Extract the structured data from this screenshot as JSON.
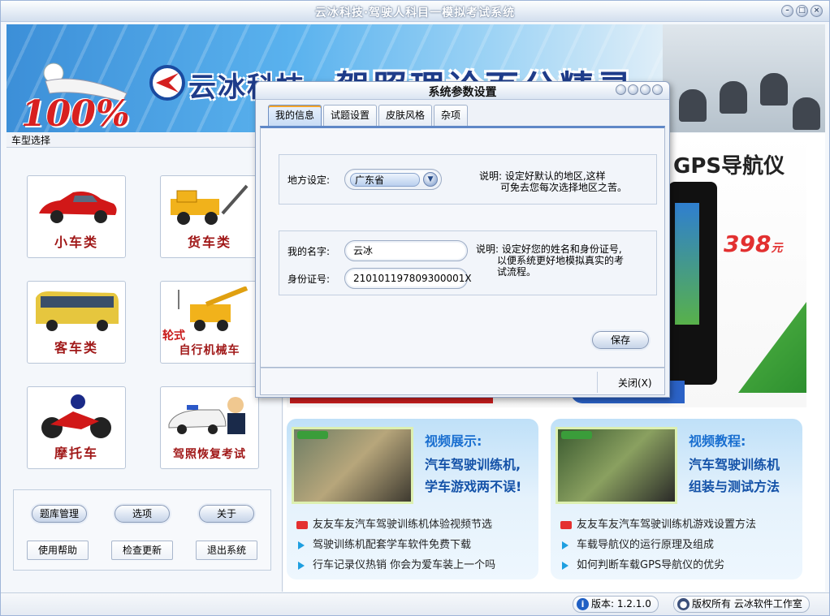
{
  "window": {
    "title": "云冰科技·驾驶人科目一模拟考试系统"
  },
  "banner": {
    "badge": "100%",
    "brand": "云冰科技",
    "product": "驾照理论百分精灵"
  },
  "left_panel": {
    "section_label": "车型选择",
    "car_types": [
      {
        "label": "小车类",
        "icon": "car-icon"
      },
      {
        "label": "货车类",
        "icon": "truck-icon"
      },
      {
        "label": "客车类",
        "icon": "bus-icon"
      },
      {
        "label": "自行机械车",
        "sub": "轮式",
        "icon": "crane-icon"
      },
      {
        "label": "摩托车",
        "icon": "motorcycle-icon"
      },
      {
        "label": "驾照恢复考试",
        "icon": "police-icon"
      }
    ],
    "buttons": {
      "question_bank": "题库管理",
      "options": "选项",
      "about": "关于",
      "help": "使用帮助",
      "update": "检查更新",
      "exit": "退出系统"
    }
  },
  "ad": {
    "gps_title": "GPS导航仪",
    "price": "398",
    "price_unit": "元"
  },
  "video_cards": [
    {
      "title": "视频展示:",
      "lines": [
        "汽车驾驶训练机,",
        "学车游戏两不误!"
      ],
      "items": [
        "友友车友汽车驾驶训练机体验视频节选",
        "驾驶训练机配套学车软件免费下载",
        "行车记录仪热销 你会为爱车装上一个吗"
      ]
    },
    {
      "title": "视频教程:",
      "lines": [
        "汽车驾驶训练机",
        "组装与测试方法"
      ],
      "items": [
        "友友车友汽车驾驶训练机游戏设置方法",
        "车载导航仪的运行原理及组成",
        "如何判断车载GPS导航仪的优劣"
      ]
    }
  ],
  "status_bar": {
    "version": "版本: 1.2.1.0",
    "copyright": "版权所有 云冰软件工作室"
  },
  "dialog": {
    "title": "系统参数设置",
    "tabs": [
      "我的信息",
      "试题设置",
      "皮肤风格",
      "杂项"
    ],
    "active_tab": 0,
    "region_label": "地方设定:",
    "region_value": "广东省",
    "region_note_1": "说明: 设定好默认的地区,这样",
    "region_note_2": "可免去您每次选择地区之苦。",
    "name_label": "我的名字:",
    "name_value": "云冰",
    "id_label": "身份证号:",
    "id_value": "210101197809300001X",
    "info_note_1": "说明: 设定好您的姓名和身份证号,",
    "info_note_2": "以便系统更好地模拟真实的考",
    "info_note_3": "试流程。",
    "save_label": "保存",
    "close_label": "关闭(X)"
  }
}
